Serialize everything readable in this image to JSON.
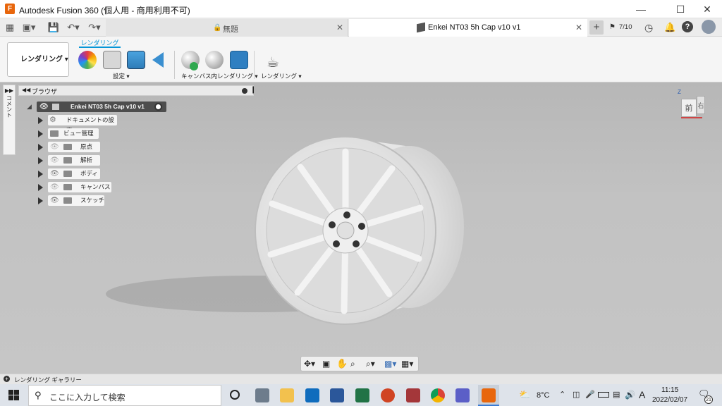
{
  "window": {
    "title": "Autodesk Fusion 360 (個人用 - 商用利用不可)",
    "logo_letter": "F"
  },
  "tabbar": {
    "tabs": [
      {
        "label": "無題"
      },
      {
        "label": "Enkei NT03 5h Cap v10 v1"
      }
    ],
    "job_count": "7/10"
  },
  "ribbon": {
    "workspace_label": "レンダリング",
    "active_tab": "レンダリング",
    "groups": [
      {
        "label": "設定 ▾"
      },
      {
        "label": "キャンバス内レンダリング ▾"
      },
      {
        "label": "レンダリング ▾"
      }
    ]
  },
  "browser": {
    "title": "ブラウザ",
    "comments_label": "コメント",
    "root": "Enkei NT03 5h Cap v10 v1",
    "items": [
      {
        "label": "ドキュメントの設定"
      },
      {
        "label": "ビュー管理"
      },
      {
        "label": "原点"
      },
      {
        "label": "解析"
      },
      {
        "label": "ボディ"
      },
      {
        "label": "キャンバス"
      },
      {
        "label": "スケッチ"
      }
    ]
  },
  "viewcube": {
    "top_label": "Z",
    "front_label": "前",
    "right_label": "右"
  },
  "statusbar": {
    "label": "レンダリング ギャラリー"
  },
  "taskbar": {
    "search_placeholder": "ここに入力して検索",
    "temperature": "8°C",
    "ime": "A",
    "time": "11:15",
    "date": "2022/02/07",
    "notifications": "21"
  },
  "colors": {
    "accent": "#0696d7",
    "fusion_orange": "#e8660c",
    "canvas": "#c0c0c0",
    "wheel": "#ececec"
  }
}
